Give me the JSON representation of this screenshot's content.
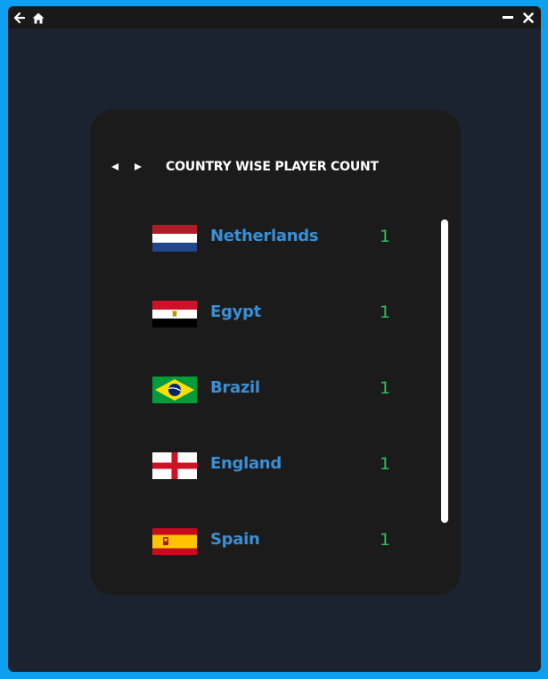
{
  "window": {
    "titlebar_icons": [
      "back-arrow-icon",
      "home-icon",
      "minimize-icon",
      "close-icon"
    ]
  },
  "card": {
    "title": "COUNTRY WISE PLAYER COUNT",
    "nav_icons": [
      "prev-arrow-icon",
      "next-arrow-icon"
    ]
  },
  "countries": [
    {
      "name": "Netherlands",
      "count": "1",
      "flag": "netherlands-flag"
    },
    {
      "name": "Egypt",
      "count": "1",
      "flag": "egypt-flag"
    },
    {
      "name": "Brazil",
      "count": "1",
      "flag": "brazil-flag"
    },
    {
      "name": "England",
      "count": "1",
      "flag": "england-flag"
    },
    {
      "name": "Spain",
      "count": "1",
      "flag": "spain-flag"
    }
  ],
  "colors": {
    "frame": "#0ea0f0",
    "window_bg": "#1b2331",
    "card_bg": "#1b1b1b",
    "country_text": "#3a8fd6",
    "count_text": "#2ebf5e"
  }
}
